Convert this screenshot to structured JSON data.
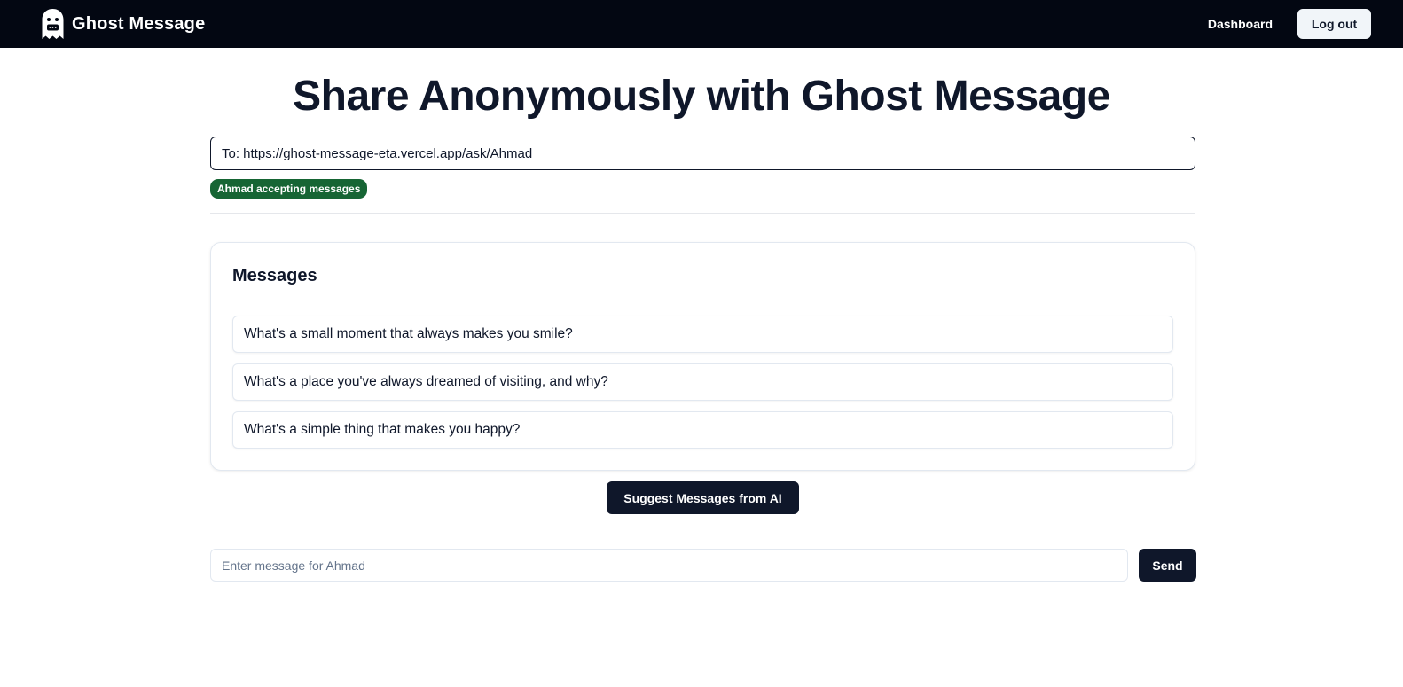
{
  "navbar": {
    "brand_name": "Ghost Message",
    "logo_icon": "ghost-icon",
    "dashboard_label": "Dashboard",
    "logout_label": "Log out",
    "background_color": "#030712"
  },
  "main": {
    "title": "Share Anonymously with Ghost Message",
    "recipient_url": "To: https://ghost-message-eta.vercel.app/ask/Ahmad",
    "status_badge": "Ahmad accepting messages",
    "status_color": "#166534"
  },
  "messages": {
    "heading": "Messages",
    "items": [
      "What's a small moment that always makes you smile?",
      "What's a place you've always dreamed of visiting, and why?",
      "What's a simple thing that makes you happy?"
    ]
  },
  "actions": {
    "suggest_label": "Suggest Messages from AI",
    "input_placeholder": "Enter message for Ahmad",
    "input_value": "",
    "send_label": "Send",
    "primary_color": "#0f172a"
  }
}
